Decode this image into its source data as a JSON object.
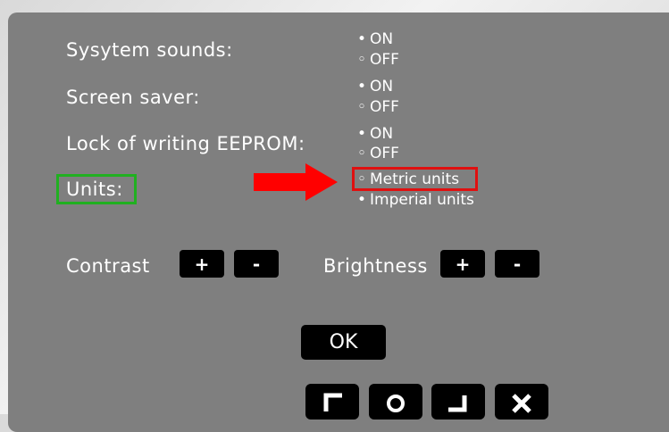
{
  "settings": {
    "system_sounds": {
      "label": "Sysytem sounds:",
      "on": "ON",
      "off": "OFF",
      "on_bullet": "•",
      "off_bullet": "◦"
    },
    "screen_saver": {
      "label": "Screen saver:",
      "on": "ON",
      "off": "OFF",
      "on_bullet": "•",
      "off_bullet": "◦"
    },
    "eeprom_lock": {
      "label": "Lock of writing EEPROM:",
      "on": "ON",
      "off": "OFF",
      "on_bullet": "•",
      "off_bullet": "◦"
    },
    "units": {
      "label": "Units:",
      "metric": "Metric units",
      "imperial": "Imperial units",
      "metric_bullet": "◦",
      "imperial_bullet": "•"
    }
  },
  "contrast": {
    "label": "Contrast",
    "plus": "+",
    "minus": "-"
  },
  "brightness": {
    "label": "Brightness",
    "plus": "+",
    "minus": "-"
  },
  "ok_label": "OK",
  "nav_icons": [
    "corner-top-left-icon",
    "circle-icon",
    "corner-bottom-right-icon",
    "close-icon"
  ],
  "colors": {
    "panel": "#7f7f7f",
    "highlight_green": "#20b020",
    "highlight_red": "#e01010",
    "arrow": "#ff0000"
  }
}
